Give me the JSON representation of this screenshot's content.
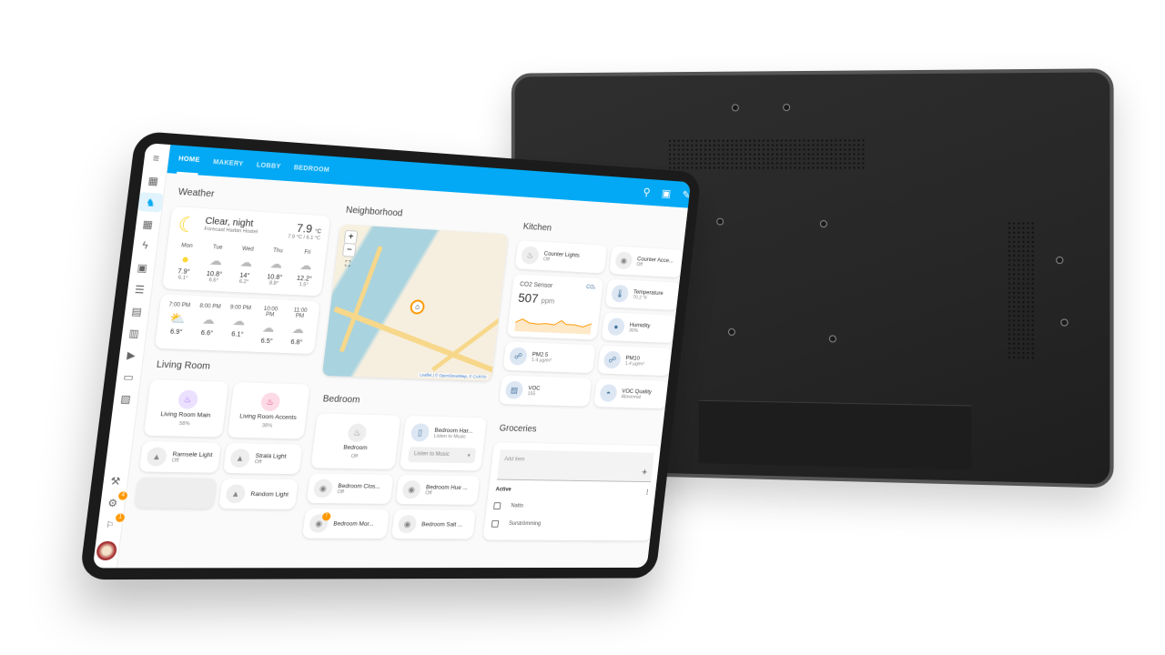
{
  "header": {
    "tabs": [
      {
        "label": "HOME",
        "active": true
      },
      {
        "label": "MAKERY",
        "active": false
      },
      {
        "label": "LOBBY",
        "active": false
      },
      {
        "label": "BEDROOM",
        "active": false
      }
    ],
    "icons": [
      "search-icon",
      "assist-chat-icon",
      "edit-pencil-icon"
    ],
    "accent_color": "#03a9f4"
  },
  "sidebar": {
    "items": [
      {
        "icon": "menu-icon",
        "glyph": "≡"
      },
      {
        "icon": "dashboard-icon",
        "glyph": "▦"
      },
      {
        "icon": "cat-dashboard-icon",
        "glyph": "♞",
        "active": true
      },
      {
        "icon": "dashboard-icon",
        "glyph": "▦"
      },
      {
        "icon": "energy-icon",
        "glyph": "ϟ"
      },
      {
        "icon": "person-board-icon",
        "glyph": "▣"
      },
      {
        "icon": "list-icon",
        "glyph": "☰"
      },
      {
        "icon": "history-chart-icon",
        "glyph": "▤"
      },
      {
        "icon": "calendar-icon",
        "glyph": "▥"
      },
      {
        "icon": "media-icon",
        "glyph": "▶"
      },
      {
        "icon": "terminal-icon",
        "glyph": "▭"
      },
      {
        "icon": "clipboard-icon",
        "glyph": "▧"
      }
    ],
    "bottom": [
      {
        "icon": "developer-tools-hammer-icon",
        "glyph": "⚒"
      },
      {
        "icon": "settings-gear-icon",
        "glyph": "⚙",
        "badge": "4"
      },
      {
        "icon": "notifications-bell-icon",
        "glyph": "🔔",
        "badge": "1"
      }
    ]
  },
  "weather": {
    "section_title": "Weather",
    "condition": "Clear, night",
    "location": "Forecast Harbin Hostel",
    "temperature": "7.9",
    "unit": "°C",
    "range": "7.9 °C / 6.1 °C",
    "daily": [
      {
        "day": "Mon",
        "icon": "sun",
        "hi": "7.9°",
        "lo": "6.1°"
      },
      {
        "day": "Tue",
        "icon": "cloud-rain",
        "hi": "10.8°",
        "lo": "6.6°"
      },
      {
        "day": "Wed",
        "icon": "cloud",
        "hi": "14°",
        "lo": "6.2°"
      },
      {
        "day": "Thu",
        "icon": "cloud",
        "hi": "10.8°",
        "lo": "8.8°"
      },
      {
        "day": "Fri",
        "icon": "cloud",
        "hi": "12.2°",
        "lo": "1.5°"
      }
    ],
    "hourly": [
      {
        "time": "7:00 PM",
        "icon": "partly-cloudy",
        "temp": "6.9°"
      },
      {
        "time": "8:00 PM",
        "icon": "cloud",
        "temp": "6.6°"
      },
      {
        "time": "9:00 PM",
        "icon": "cloud",
        "temp": "6.1°"
      },
      {
        "time": "10:00 PM",
        "icon": "cloud",
        "temp": "6.5°"
      },
      {
        "time": "11:00 PM",
        "icon": "cloud",
        "temp": "6.8°"
      }
    ]
  },
  "neighborhood": {
    "section_title": "Neighborhood",
    "zoom_in": "+",
    "zoom_out": "−",
    "attribution": "Leaflet | © OpenStreetMap, © CARTO"
  },
  "kitchen": {
    "section_title": "Kitchen",
    "tiles": [
      {
        "name": "Counter Lights",
        "state": "Off",
        "icon": "chandelier-icon"
      },
      {
        "name": "Counter Acce...",
        "state": "Off",
        "icon": "bulb-icon"
      },
      {
        "name": "Temperature",
        "state": "70.2 °F",
        "icon": "thermometer-icon"
      },
      {
        "name": "Humidity",
        "state": "30%",
        "icon": "water-percent-icon"
      },
      {
        "name": "PM2.5",
        "state": "1.4 µg/m³",
        "icon": "molecule-icon"
      },
      {
        "name": "PM10",
        "state": "1.4 µg/m³",
        "icon": "molecule-icon"
      },
      {
        "name": "VOC",
        "state": "155",
        "icon": "voc-icon"
      },
      {
        "name": "VOC Quality",
        "state": "Abnormal",
        "icon": "air-quality-icon"
      }
    ],
    "co2": {
      "name": "CO2 Sensor",
      "value": "507",
      "unit": "ppm",
      "icon_label": "CO₂",
      "color": "#ff9800"
    }
  },
  "living_room": {
    "section_title": "Living Room",
    "big_tiles": [
      {
        "name": "Living Room Main",
        "state": "58%",
        "color": "#a26bff",
        "bg": "#ece0ff"
      },
      {
        "name": "Living Room Accents",
        "state": "38%",
        "color": "#e8336b",
        "bg": "#fddbe6"
      }
    ],
    "tiles": [
      {
        "name": "Ramsele Light",
        "state": "Off"
      },
      {
        "name": "Strala Light",
        "state": "Off"
      },
      {
        "name": "",
        "state": ""
      },
      {
        "name": "Random Light",
        "state": ""
      }
    ]
  },
  "bedroom": {
    "section_title": "Bedroom",
    "main": {
      "name": "Bedroom",
      "state": "Off"
    },
    "harmony": {
      "name": "Bedroom Har...",
      "state": "Listen to Music",
      "select_value": "Listen to Music"
    },
    "tiles": [
      {
        "name": "Bedroom Clos...",
        "state": "Off"
      },
      {
        "name": "Bedroom Hue ...",
        "state": "Off"
      },
      {
        "name": "Bedroom Mor...",
        "state": "",
        "badge": "!"
      },
      {
        "name": "Bedroom Salt ...",
        "state": ""
      }
    ]
  },
  "groceries": {
    "section_title": "Groceries",
    "add_placeholder": "Add item",
    "active_label": "Active",
    "items": [
      {
        "name": "Natto",
        "checked": false
      },
      {
        "name": "Surströmming",
        "checked": false
      }
    ]
  }
}
